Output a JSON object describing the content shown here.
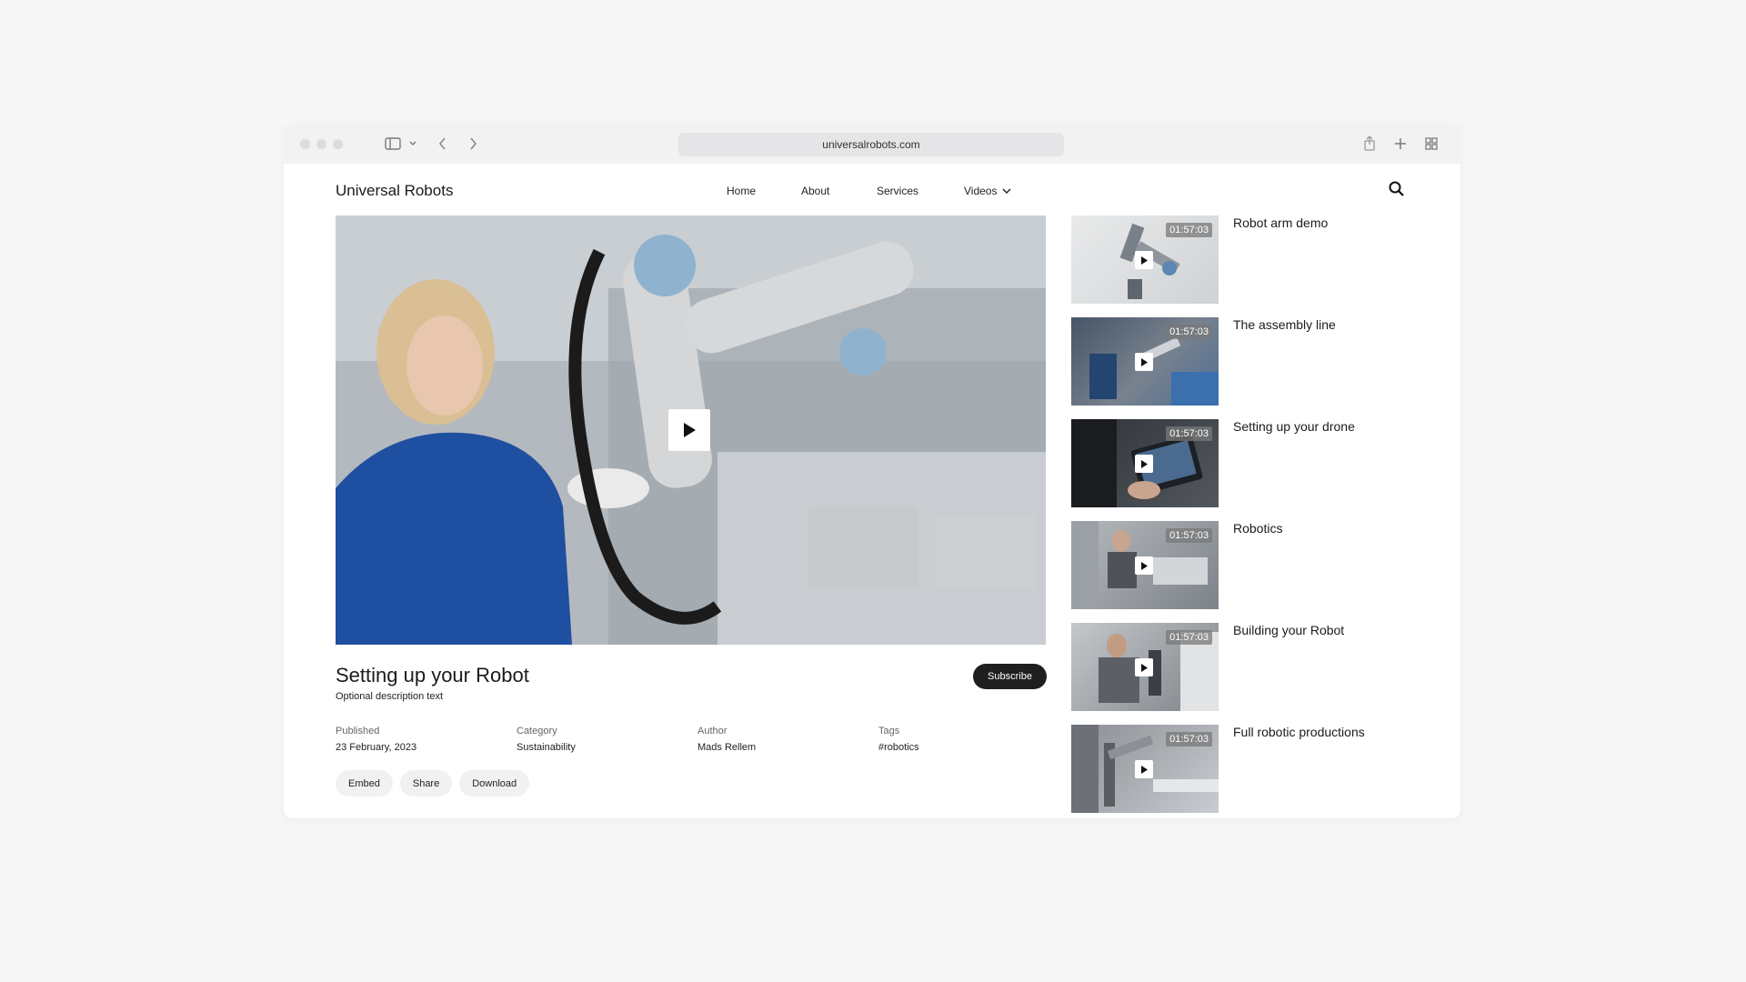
{
  "browser": {
    "url": "universalrobots.com"
  },
  "site": {
    "logo": "Universal Robots",
    "nav": [
      {
        "label": "Home"
      },
      {
        "label": "About"
      },
      {
        "label": "Services"
      },
      {
        "label": "Videos"
      }
    ]
  },
  "video": {
    "title": "Setting up your Robot",
    "description": "Optional description text",
    "subscribe_label": "Subscribe",
    "meta": [
      {
        "label": "Published",
        "value": "23 February, 2023"
      },
      {
        "label": "Category",
        "value": "Sustainability"
      },
      {
        "label": "Author",
        "value": "Mads Rellem"
      },
      {
        "label": "Tags",
        "value": "#robotics"
      }
    ],
    "actions": [
      {
        "label": "Embed"
      },
      {
        "label": "Share"
      },
      {
        "label": "Download"
      }
    ]
  },
  "sidebar": {
    "items": [
      {
        "title": "Robot arm demo",
        "duration": "01:57:03"
      },
      {
        "title": "The assembly line",
        "duration": "01:57:03"
      },
      {
        "title": "Setting up your drone",
        "duration": "01:57:03"
      },
      {
        "title": "Robotics",
        "duration": "01:57:03"
      },
      {
        "title": "Building your Robot",
        "duration": "01:57:03"
      },
      {
        "title": "Full robotic productions",
        "duration": "01:57:03"
      }
    ]
  }
}
